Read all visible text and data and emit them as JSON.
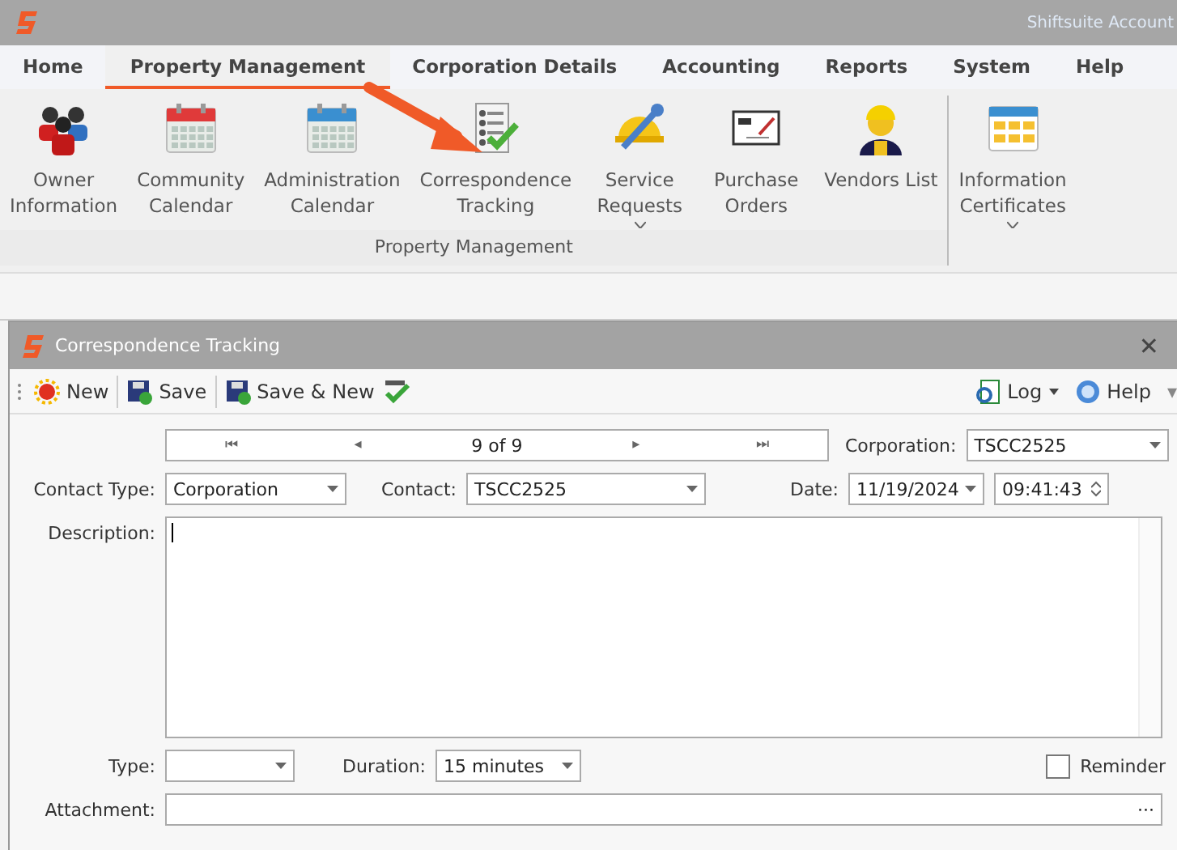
{
  "app_title": "Shiftsuite Account",
  "menu_tabs": [
    {
      "label": "Home",
      "selected": false
    },
    {
      "label": "Property Management",
      "selected": true
    },
    {
      "label": "Corporation Details",
      "selected": false
    },
    {
      "label": "Accounting",
      "selected": false
    },
    {
      "label": "Reports",
      "selected": false
    },
    {
      "label": "System",
      "selected": false
    },
    {
      "label": "Help",
      "selected": false
    }
  ],
  "ribbon": {
    "groups": [
      {
        "label": "Property Management",
        "items": [
          {
            "kind": "people",
            "lines": [
              "Owner",
              "Information"
            ],
            "dropdown": false
          },
          {
            "kind": "calendar",
            "color": "#e03a3a",
            "lines": [
              "Community",
              "Calendar"
            ],
            "dropdown": false
          },
          {
            "kind": "calendar",
            "color": "#3a8fd0",
            "lines": [
              "Administration",
              "Calendar"
            ],
            "dropdown": false
          },
          {
            "kind": "checklist",
            "lines": [
              "Correspondence",
              "Tracking"
            ],
            "dropdown": false
          },
          {
            "kind": "tools",
            "lines": [
              "Service",
              "Requests"
            ],
            "dropdown": true
          },
          {
            "kind": "order",
            "lines": [
              "Purchase",
              "Orders"
            ],
            "dropdown": false
          },
          {
            "kind": "worker",
            "lines": [
              "Vendors List"
            ],
            "dropdown": false
          }
        ]
      },
      {
        "items": [
          {
            "kind": "folders",
            "lines": [
              "Information",
              "Certificates"
            ],
            "dropdown": true
          }
        ]
      }
    ]
  },
  "window": {
    "title": "Correspondence Tracking",
    "close": "✕"
  },
  "toolbar": {
    "left": [
      {
        "kind": "new",
        "label": "New"
      },
      {
        "kind": "save",
        "label": "Save"
      },
      {
        "kind": "save",
        "label": "Save & New"
      },
      {
        "kind": "spell"
      }
    ],
    "right": [
      {
        "kind": "log",
        "label": "Log",
        "dropdown": true
      },
      {
        "kind": "help",
        "label": "Help",
        "dropdown": false
      }
    ],
    "overflow": "▾"
  },
  "navigator": {
    "first": "⏮",
    "prev": "◂",
    "position": "9 of 9",
    "next": "▸",
    "last": "⏭"
  },
  "form": {
    "corporation": {
      "label": "Corporation:",
      "value": "TSCC2525"
    },
    "contact_type": {
      "label": "Contact Type:",
      "value": "Corporation"
    },
    "contact": {
      "label": "Contact:",
      "value": "TSCC2525"
    },
    "date": {
      "label": "Date:",
      "value": "11/19/2024",
      "time": "09:41:43"
    },
    "description": {
      "label": "Description:"
    },
    "type": {
      "label": "Type:"
    },
    "duration": {
      "label": "Duration:",
      "value": "15 minutes"
    },
    "reminder": {
      "label": "Reminder",
      "checked": false
    },
    "attachment": {
      "label": "Attachment:",
      "button": "···"
    }
  }
}
